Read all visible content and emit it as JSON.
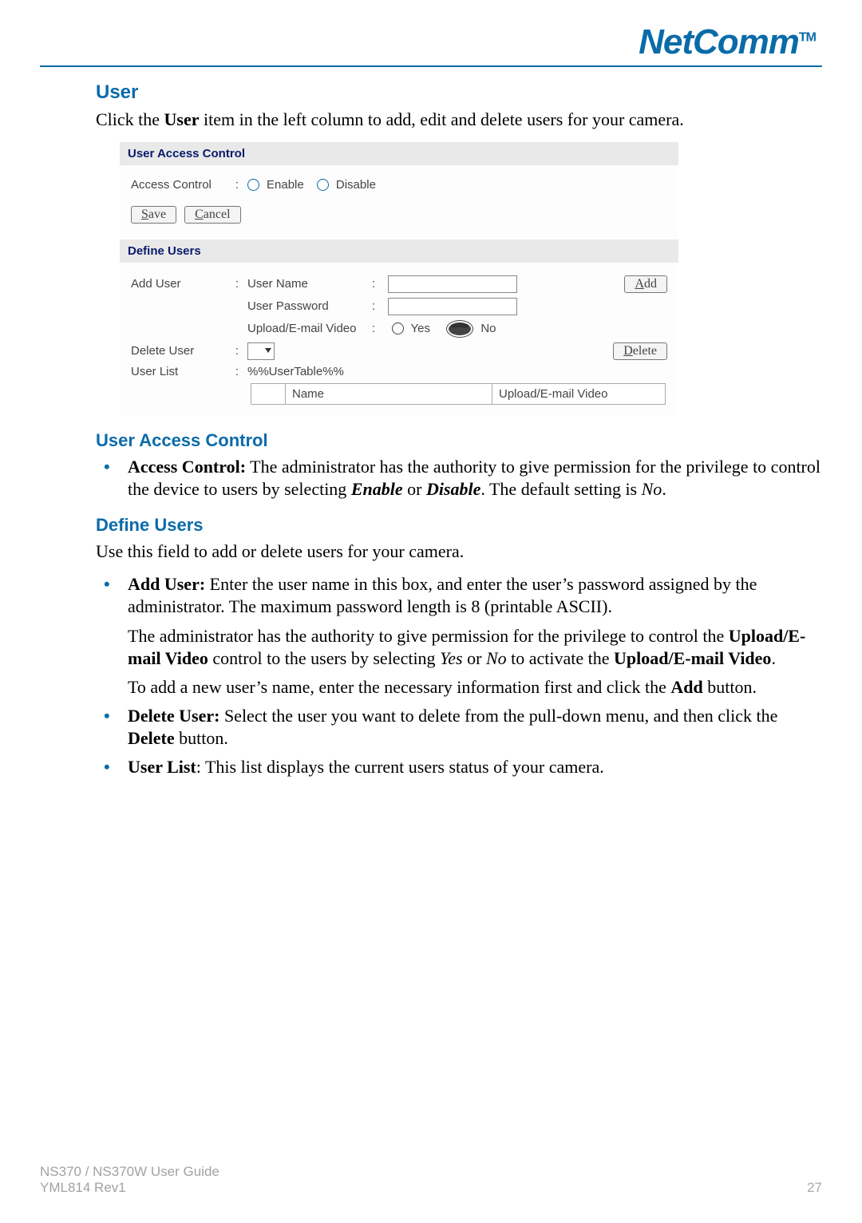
{
  "logo": {
    "text": "NetComm",
    "tm": "TM"
  },
  "h_user": "User",
  "p_intro_pre": "Click the ",
  "p_intro_bold": "User",
  "p_intro_post": " item in the left column to add, edit and delete users for your camera.",
  "panel": {
    "uac_head": "User Access Control",
    "access_label": "Access Control",
    "enable": "Enable",
    "disable": "Disable",
    "save_u": "S",
    "save_rest": "ave",
    "cancel_u": "C",
    "cancel_rest": "ancel",
    "du_head": "Define Users",
    "add_user": "Add User",
    "uname": "User Name",
    "upwd": "User Password",
    "uev": "Upload/E-mail Video",
    "yes": "Yes",
    "no": "No",
    "add_btn_u": "A",
    "add_btn_rest": "dd",
    "del_user": "Delete User",
    "del_btn_u": "D",
    "del_btn_rest": "elete",
    "user_list": "User List",
    "ut_token": "%%UserTable%%",
    "th_name": "Name",
    "th_uev": "Upload/E-mail Video"
  },
  "h_uac": "User Access Control",
  "b_uac_b1": "Access Control:",
  "b_uac_t1": " The administrator has the authority to give permission for the privilege to control the device to users by selecting ",
  "b_uac_i1": "Enable",
  "b_uac_t2": " or ",
  "b_uac_i2": "Disable",
  "b_uac_t3": ".  The default setting is ",
  "b_uac_i3": "No",
  "b_uac_t4": ".",
  "h_du": "Define Users",
  "p_du": "Use this field to add or delete users for your camera.",
  "b_add_b": "Add User:",
  "b_add_t1": " Enter the user name in this box, and enter the user’s password assigned by the administrator.  The maximum password length is 8 (printable ASCII).",
  "b_add_p2a": "The administrator has the authority to give permission for the privilege to control the ",
  "b_add_p2b": "Upload/E-mail Video",
  "b_add_p2c": " control to the users by selecting ",
  "b_add_p2d": "Yes",
  "b_add_p2e": " or ",
  "b_add_p2f": "No",
  "b_add_p2g": " to activate the ",
  "b_add_p2h": "Upload/E-mail Video",
  "b_add_p2i": ".",
  "b_add_p3a": "To add a new user’s name, enter the necessary information first and click the ",
  "b_add_p3b": "Add",
  "b_add_p3c": " button.",
  "b_del_b": "Delete User:",
  "b_del_t1": " Select the user you want to delete from the pull-down menu, and then click the ",
  "b_del_t2": "Delete",
  "b_del_t3": " button.",
  "b_ul_b": "User List",
  "b_ul_t": ": This list displays the current users status of your camera.",
  "footer": {
    "line1": "NS370 / NS370W User Guide",
    "line2": "YML814 Rev1",
    "page": "27"
  }
}
